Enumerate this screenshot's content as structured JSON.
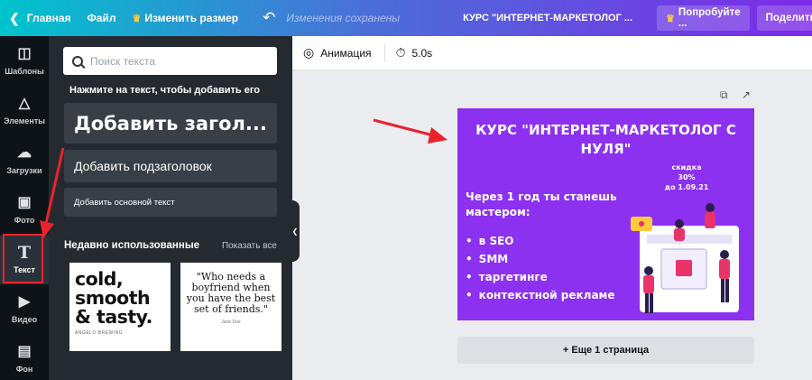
{
  "topbar": {
    "home": "Главная",
    "file": "Файл",
    "resize": "Изменить размер",
    "saved": "Изменения сохранены",
    "title": "КУРС \"ИНТЕРНЕТ-МАРКЕТОЛОГ ...",
    "try_pro": "Попробуйте ...",
    "share": "Поделиться"
  },
  "rail": {
    "items": [
      {
        "label": "Шаблоны",
        "icon": "layout-icon"
      },
      {
        "label": "Элементы",
        "icon": "shapes-icon"
      },
      {
        "label": "Загрузки",
        "icon": "upload-cloud-icon"
      },
      {
        "label": "Фото",
        "icon": "image-icon"
      },
      {
        "label": "Текст",
        "icon": "text-T-icon"
      },
      {
        "label": "Видео",
        "icon": "video-icon"
      },
      {
        "label": "Фон",
        "icon": "background-hatch-icon"
      }
    ]
  },
  "panel": {
    "search_placeholder": "Поиск текста",
    "hint": "Нажмите на текст, чтобы добавить его",
    "add_heading": "Добавить загол...",
    "add_subheading": "Добавить подзаголовок",
    "add_body": "Добавить основной текст",
    "recent_title": "Недавно использованные",
    "show_all": "Показать все",
    "template1_text": "cold, smooth & tasty.",
    "template1_small": "ANGELO BREWING",
    "template2_text": "\"Who needs a boyfriend when you have the best set of friends.\"",
    "template2_small": "Jane Doe"
  },
  "toolbar": {
    "animation": "Анимация",
    "duration": "5.0s"
  },
  "design": {
    "title": "КУРС \"ИНТЕРНЕТ-МАРКЕТОЛОГ С НУЛЯ\"",
    "sale_line1": "скидка",
    "sale_line2": "30%",
    "sale_line3": "до 1.09.21",
    "intro_line1": "Через 1 год ты станешь",
    "intro_line2": "мастером:",
    "list": [
      "в SEO",
      "SMM",
      "таргетинге",
      "контекстной рекламе"
    ],
    "background": "#8c31f0"
  },
  "add_page": "+ Еще 1 страница",
  "colors": {
    "accent_purple": "#7d2ae8",
    "accent_teal": "#00c4cc",
    "annotation_red": "#e8232b"
  }
}
